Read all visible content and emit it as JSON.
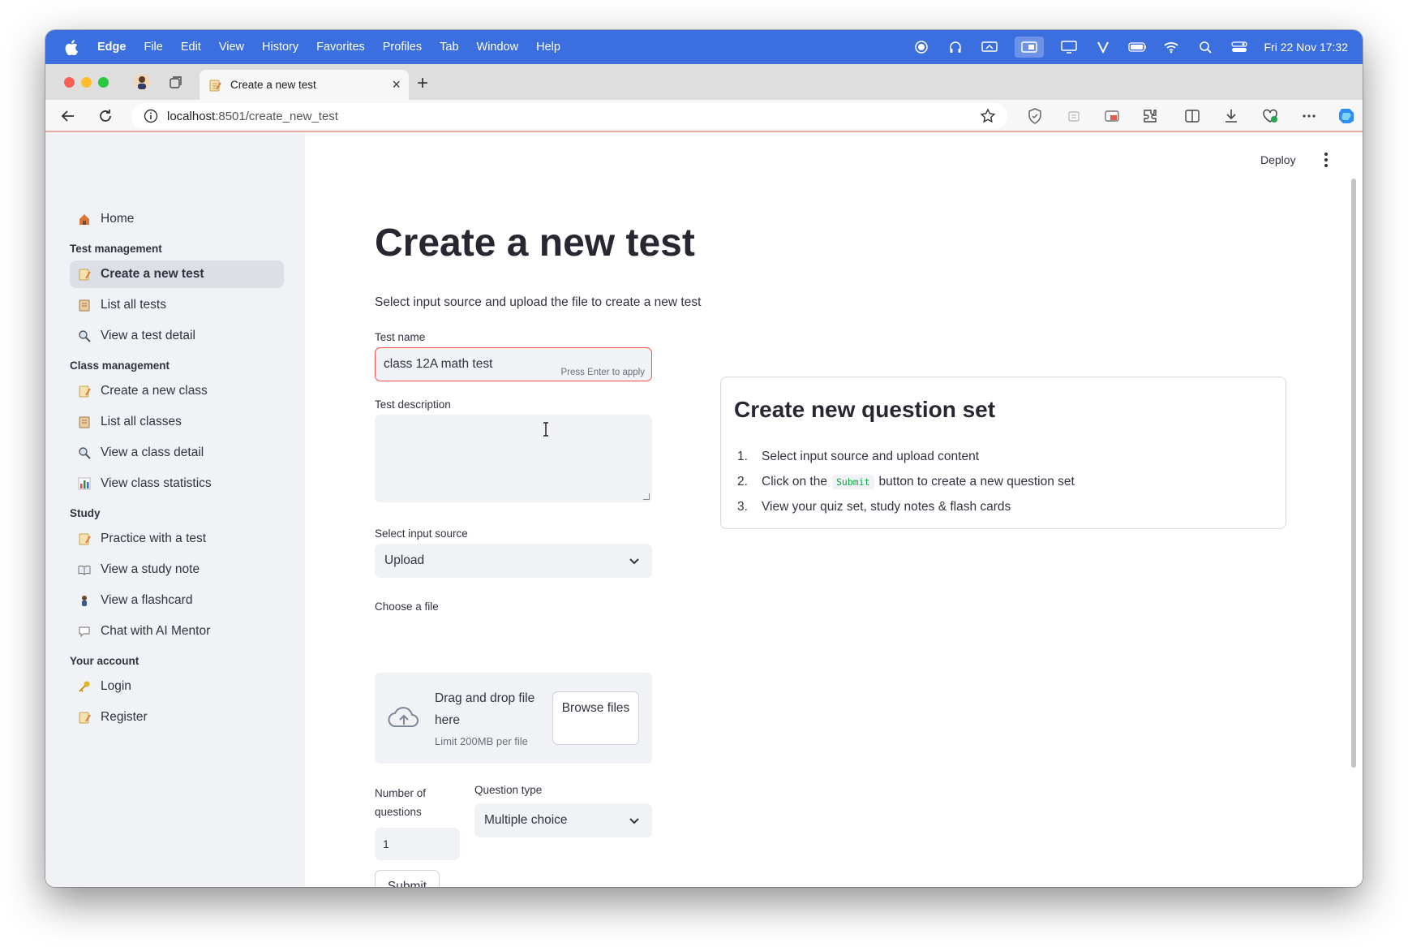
{
  "menubar": {
    "app_name": "Edge",
    "items": [
      "File",
      "Edit",
      "View",
      "History",
      "Favorites",
      "Profiles",
      "Tab",
      "Window",
      "Help"
    ],
    "clock": "Fri 22 Nov  17:32"
  },
  "browser": {
    "tab_title": "Create a new test",
    "url_host": "localhost",
    "url_rest": ":8501/create_new_test"
  },
  "header": {
    "deploy_label": "Deploy"
  },
  "sidebar": {
    "home": "Home",
    "sections": [
      {
        "title": "Test management",
        "items": [
          "Create a new test",
          "List all tests",
          "View a test detail"
        ]
      },
      {
        "title": "Class management",
        "items": [
          "Create a new class",
          "List all classes",
          "View a class detail",
          "View class statistics"
        ]
      },
      {
        "title": "Study",
        "items": [
          "Practice with a test",
          "View a study note",
          "View a flashcard",
          "Chat with AI Mentor"
        ]
      },
      {
        "title": "Your account",
        "items": [
          "Login",
          "Register"
        ]
      }
    ]
  },
  "main": {
    "title": "Create a new test",
    "subtitle": "Select input source and upload the file to create a new test",
    "test_name": {
      "label": "Test name",
      "value": "class 12A math test",
      "hint": "Press Enter to apply"
    },
    "test_description": {
      "label": "Test description",
      "value": ""
    },
    "input_source": {
      "label": "Select input source",
      "value": "Upload"
    },
    "file": {
      "label": "Choose a file",
      "drag_text": "Drag and drop file here",
      "limit": "Limit 200MB per file",
      "browse": "Browse files"
    },
    "num_questions": {
      "label": "Number of questions",
      "value": "1"
    },
    "question_type": {
      "label": "Question type",
      "value": "Multiple choice"
    },
    "submit": "Submit"
  },
  "info": {
    "title": "Create new question set",
    "steps": [
      {
        "num": "1.",
        "text": "Select input source and upload content"
      },
      {
        "num": "2.",
        "pre": "Click on the",
        "code": "Submit",
        "post": "button to create a new question set"
      },
      {
        "num": "3.",
        "text": "View your quiz set, study notes & flash cards"
      }
    ]
  },
  "colors": {
    "menubar": "#3b6fe0",
    "sidebar": "#f0f2f6",
    "accent_red": "#ff4b4b",
    "code_green": "#09ab3b"
  }
}
